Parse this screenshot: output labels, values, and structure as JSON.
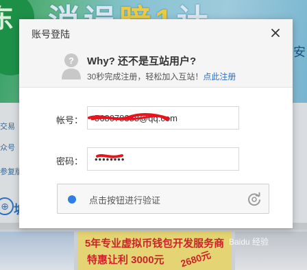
{
  "background": {
    "banner_left_char": "东",
    "banner_text_a": "消误",
    "banner_text_b": "暗1",
    "banner_text_c": "计",
    "banner_right": "奥安",
    "left_items": [
      "交易",
      "众号",
      "参复版"
    ],
    "left_big": "坡",
    "promo_line1": "5年专业虚拟币钱包开发服务商",
    "promo_line2": "特惠让利 3000元",
    "promo_tag": "2680元"
  },
  "dialog": {
    "title": "账号登陆",
    "close_label": "×",
    "notice": {
      "headline": "Why? 还不是互站用户?",
      "subtitle": "30秒完成注册，轻松加入互站！",
      "register_link": "点此注册"
    },
    "account": {
      "label": "帐号：",
      "value": "568078388@qq.com"
    },
    "password": {
      "label": "密码：",
      "value": "••••••••"
    },
    "verify": {
      "label": "点击按钮进行验证"
    }
  },
  "watermark": "Baidu 经验",
  "colors": {
    "link": "#2f6fbf",
    "verify_dot": "#2f7ee6",
    "scribble": "#e6141c"
  }
}
